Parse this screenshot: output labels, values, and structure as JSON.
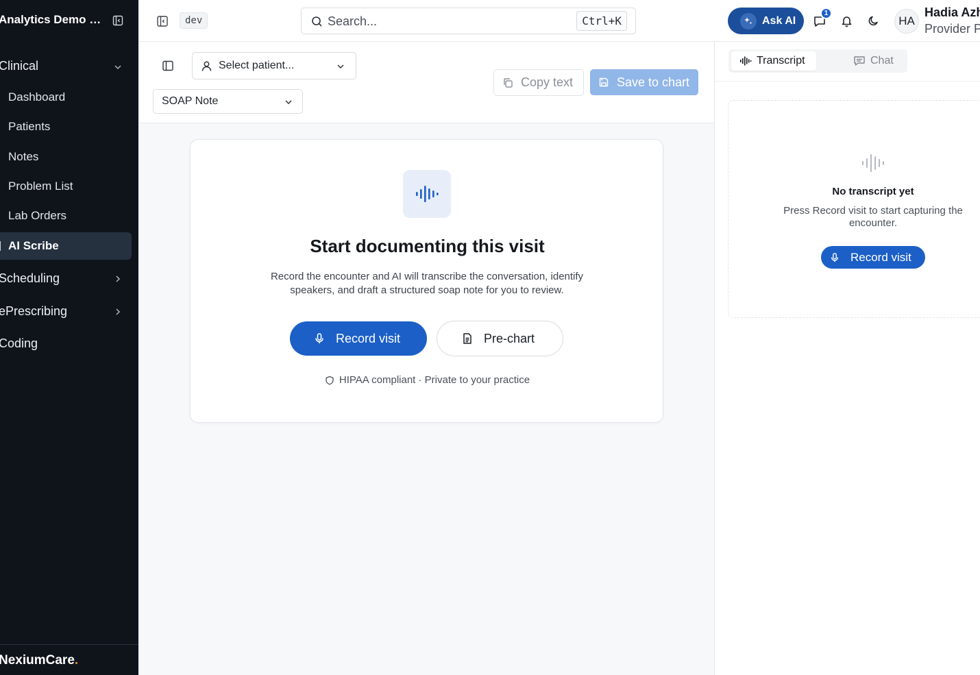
{
  "sidebar": {
    "org_title": "Analytics Demo Clinic",
    "sections": {
      "clinical": "Clinical",
      "scheduling": "Scheduling",
      "prescribing": "ePrescribing",
      "coding": "Coding"
    },
    "items": [
      {
        "label": "Dashboard",
        "active": false
      },
      {
        "label": "Patients",
        "active": false
      },
      {
        "label": "Notes",
        "active": false
      },
      {
        "label": "Problem List",
        "active": false
      },
      {
        "label": "Lab Orders",
        "active": false
      },
      {
        "label": "AI Scribe",
        "active": true
      }
    ],
    "logo": {
      "text": "NexiumCare",
      "dot": "."
    }
  },
  "topbar": {
    "env": "dev",
    "search": {
      "placeholder": "Search...",
      "shortcut": "Ctrl+K"
    },
    "ask_ai": "Ask AI",
    "notification_count": "1",
    "user": {
      "initials": "HA",
      "name": "Hadia Azhar",
      "role": "Provider Portal"
    }
  },
  "editor": {
    "patient_select": {
      "placeholder": "Select patient..."
    },
    "note_type": "SOAP Note",
    "copy_label": "Copy text",
    "save_label": "Save to chart"
  },
  "card": {
    "title": "Start documenting this visit",
    "description": "Record the encounter and AI will transcribe the conversation, identify speakers, and draft a structured soap note for you to review.",
    "record_label": "Record visit",
    "prechart_label": "Pre-chart",
    "compliance": "HIPAA compliant · Private to your practice"
  },
  "right_panel": {
    "tabs": [
      {
        "label": "Transcript",
        "active": true
      },
      {
        "label": "Chat",
        "active": false
      }
    ],
    "empty": {
      "title": "No transcript yet",
      "description": "Press Record visit to start capturing the encounter.",
      "record_label": "Record visit"
    }
  },
  "colors": {
    "sidebar_bg": "#0f141b",
    "primary": "#1c5fc7",
    "ask_ai": "#1b4f9c",
    "save_disabled": "#91b6e8",
    "logo_accent": "#f08a2c"
  }
}
